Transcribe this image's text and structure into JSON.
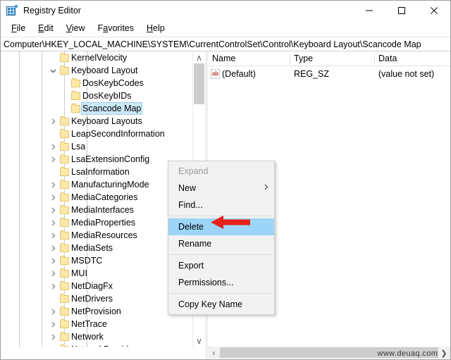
{
  "window": {
    "title": "Registry Editor",
    "icon": "registry-icon",
    "minimize_label": "—",
    "maximize_label": "□",
    "close_label": "✕"
  },
  "menubar": {
    "items": [
      {
        "label": "File",
        "accel": "F"
      },
      {
        "label": "Edit",
        "accel": "E"
      },
      {
        "label": "View",
        "accel": "V"
      },
      {
        "label": "Favorites",
        "accel": "a"
      },
      {
        "label": "Help",
        "accel": "H"
      }
    ]
  },
  "address": {
    "path": "Computer\\HKEY_LOCAL_MACHINE\\SYSTEM\\CurrentControlSet\\Control\\Keyboard Layout\\Scancode Map"
  },
  "tree": {
    "rows": [
      {
        "label": "KernelVelocity",
        "indent": 4,
        "twisty": "none",
        "selected": false
      },
      {
        "label": "Keyboard Layout",
        "indent": 4,
        "twisty": "expanded",
        "selected": false
      },
      {
        "label": "DosKeybCodes",
        "indent": 5,
        "twisty": "none",
        "selected": false
      },
      {
        "label": "DosKeybIDs",
        "indent": 5,
        "twisty": "none",
        "selected": false
      },
      {
        "label": "Scancode Map",
        "indent": 5,
        "twisty": "none",
        "selected": true
      },
      {
        "label": "Keyboard Layouts",
        "indent": 4,
        "twisty": "collapsed",
        "selected": false
      },
      {
        "label": "LeapSecondInformation",
        "indent": 4,
        "twisty": "none",
        "selected": false
      },
      {
        "label": "Lsa",
        "indent": 4,
        "twisty": "collapsed",
        "selected": false
      },
      {
        "label": "LsaExtensionConfig",
        "indent": 4,
        "twisty": "collapsed",
        "selected": false
      },
      {
        "label": "LsaInformation",
        "indent": 4,
        "twisty": "none",
        "selected": false
      },
      {
        "label": "ManufacturingMode",
        "indent": 4,
        "twisty": "collapsed",
        "selected": false
      },
      {
        "label": "MediaCategories",
        "indent": 4,
        "twisty": "collapsed",
        "selected": false
      },
      {
        "label": "MediaInterfaces",
        "indent": 4,
        "twisty": "collapsed",
        "selected": false
      },
      {
        "label": "MediaProperties",
        "indent": 4,
        "twisty": "collapsed",
        "selected": false
      },
      {
        "label": "MediaResources",
        "indent": 4,
        "twisty": "collapsed",
        "selected": false
      },
      {
        "label": "MediaSets",
        "indent": 4,
        "twisty": "collapsed",
        "selected": false
      },
      {
        "label": "MSDTC",
        "indent": 4,
        "twisty": "collapsed",
        "selected": false
      },
      {
        "label": "MUI",
        "indent": 4,
        "twisty": "collapsed",
        "selected": false
      },
      {
        "label": "NetDiagFx",
        "indent": 4,
        "twisty": "collapsed",
        "selected": false
      },
      {
        "label": "NetDrivers",
        "indent": 4,
        "twisty": "none",
        "selected": false
      },
      {
        "label": "NetProvision",
        "indent": 4,
        "twisty": "collapsed",
        "selected": false
      },
      {
        "label": "NetTrace",
        "indent": 4,
        "twisty": "collapsed",
        "selected": false
      },
      {
        "label": "Network",
        "indent": 4,
        "twisty": "collapsed",
        "selected": false
      },
      {
        "label": "NetworkProvider",
        "indent": 4,
        "twisty": "collapsed",
        "selected": false
      }
    ]
  },
  "values": {
    "columns": [
      "Name",
      "Type",
      "Data"
    ],
    "rows": [
      {
        "name": "(Default)",
        "type": "REG_SZ",
        "data": "(value not set)",
        "icon": "string-value-icon"
      }
    ]
  },
  "context_menu": {
    "items": [
      {
        "label": "Expand",
        "state": "disabled",
        "submenu": false,
        "separator_after": false
      },
      {
        "label": "New",
        "state": "normal",
        "submenu": true,
        "separator_after": false
      },
      {
        "label": "Find...",
        "state": "normal",
        "submenu": false,
        "separator_after": true
      },
      {
        "label": "Delete",
        "state": "highlight",
        "submenu": false,
        "separator_after": false
      },
      {
        "label": "Rename",
        "state": "normal",
        "submenu": false,
        "separator_after": true
      },
      {
        "label": "Export",
        "state": "normal",
        "submenu": false,
        "separator_after": false
      },
      {
        "label": "Permissions...",
        "state": "normal",
        "submenu": false,
        "separator_after": true
      },
      {
        "label": "Copy Key Name",
        "state": "normal",
        "submenu": false,
        "separator_after": false
      }
    ],
    "highlight_color": "#9cd5f7"
  },
  "annotation": {
    "arrow_color": "#e8201a",
    "points_to": "Delete"
  },
  "watermark": {
    "text": "www.deuaq.com",
    "chevron": "❯"
  },
  "scrollbars": {
    "tree_up": "∧",
    "tree_down": "∨",
    "left": "‹",
    "right": "›"
  }
}
